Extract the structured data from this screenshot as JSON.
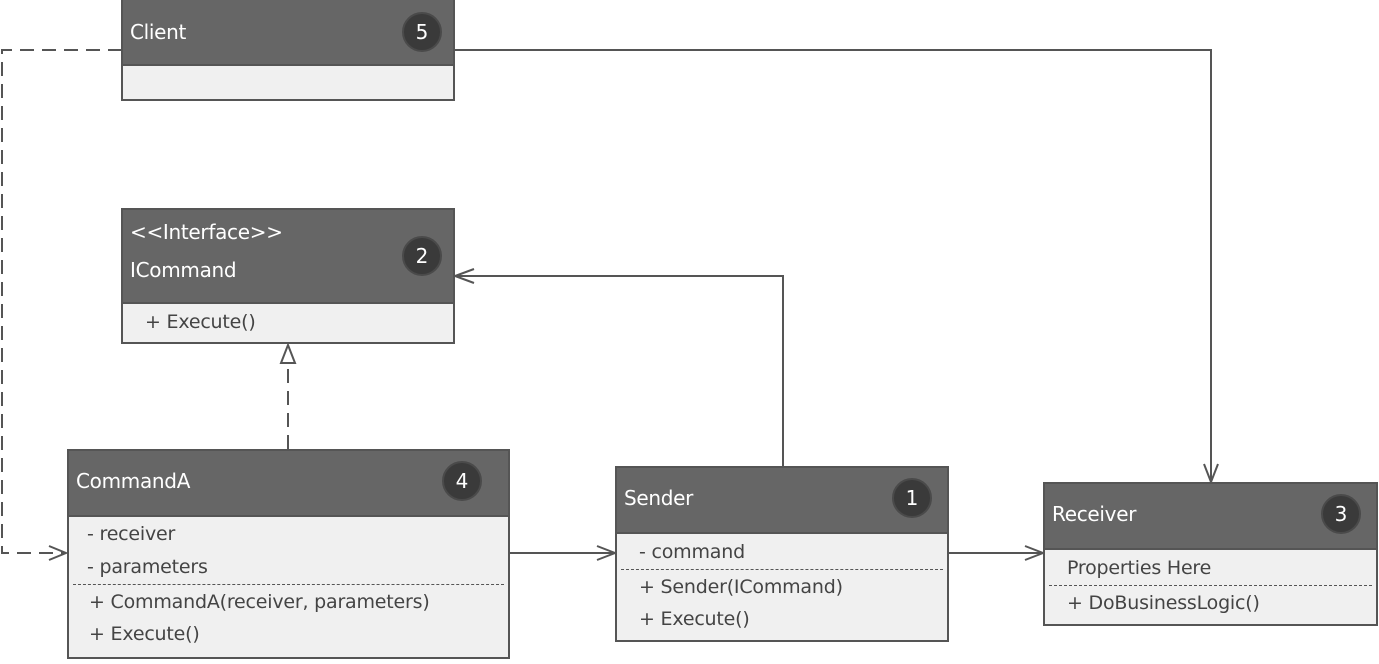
{
  "diagram": {
    "type": "uml-class-diagram",
    "pattern": "Command",
    "classes": {
      "client": {
        "name": "Client",
        "badge": "5",
        "attributes": [],
        "methods": []
      },
      "icommand": {
        "stereotype": "<<Interface>>",
        "name": "ICommand",
        "badge": "2",
        "attributes": [],
        "methods": [
          "+ Execute()"
        ]
      },
      "commanda": {
        "name": "CommandA",
        "badge": "4",
        "attributes": [
          "- receiver",
          "- parameters"
        ],
        "methods": [
          "+ CommandA(receiver, parameters)",
          "+ Execute()"
        ]
      },
      "sender": {
        "name": "Sender",
        "badge": "1",
        "attributes": [
          "- command"
        ],
        "methods": [
          "+ Sender(ICommand)",
          "+ Execute()"
        ]
      },
      "receiver": {
        "name": "Receiver",
        "badge": "3",
        "attributes": [
          "Properties Here"
        ],
        "methods": [
          "+ DoBusinessLogic()"
        ]
      }
    },
    "relationships": [
      {
        "from": "Client",
        "to": "CommandA",
        "kind": "dependency",
        "style": "dashed-open-arrow"
      },
      {
        "from": "Client",
        "to": "Receiver",
        "kind": "association",
        "style": "solid-open-arrow"
      },
      {
        "from": "CommandA",
        "to": "ICommand",
        "kind": "realization",
        "style": "dashed-hollow-triangle"
      },
      {
        "from": "CommandA",
        "to": "Sender",
        "kind": "association",
        "style": "solid-open-arrow"
      },
      {
        "from": "Sender",
        "to": "ICommand",
        "kind": "association",
        "style": "solid-open-arrow"
      },
      {
        "from": "Sender",
        "to": "Receiver",
        "kind": "association",
        "style": "solid-open-arrow"
      }
    ],
    "colors": {
      "header": "#666666",
      "body": "#f0f0f0",
      "border": "#555555",
      "badge": "#3a3a3a",
      "line": "#555555"
    }
  }
}
